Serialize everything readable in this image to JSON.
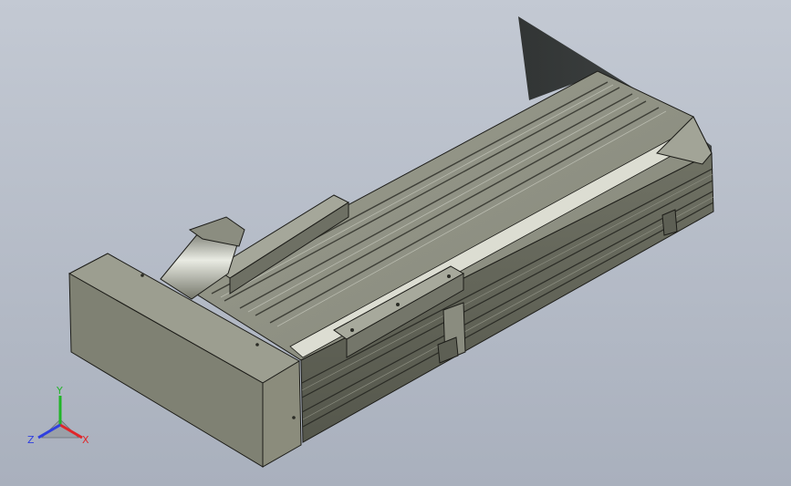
{
  "viewport": {
    "background_top": "#c3c9d3",
    "background_bottom": "#a9b0bd"
  },
  "model": {
    "body_color": "#7f8173",
    "rail_color": "#8e9083",
    "endcap_color": "#8b8c7c",
    "edge_color": "#1c1c18"
  },
  "triad": {
    "x_label": "X",
    "y_label": "Y",
    "z_label": "Z",
    "x_color": "#e0262a",
    "y_color": "#21b528",
    "z_color": "#2f3fe0"
  }
}
